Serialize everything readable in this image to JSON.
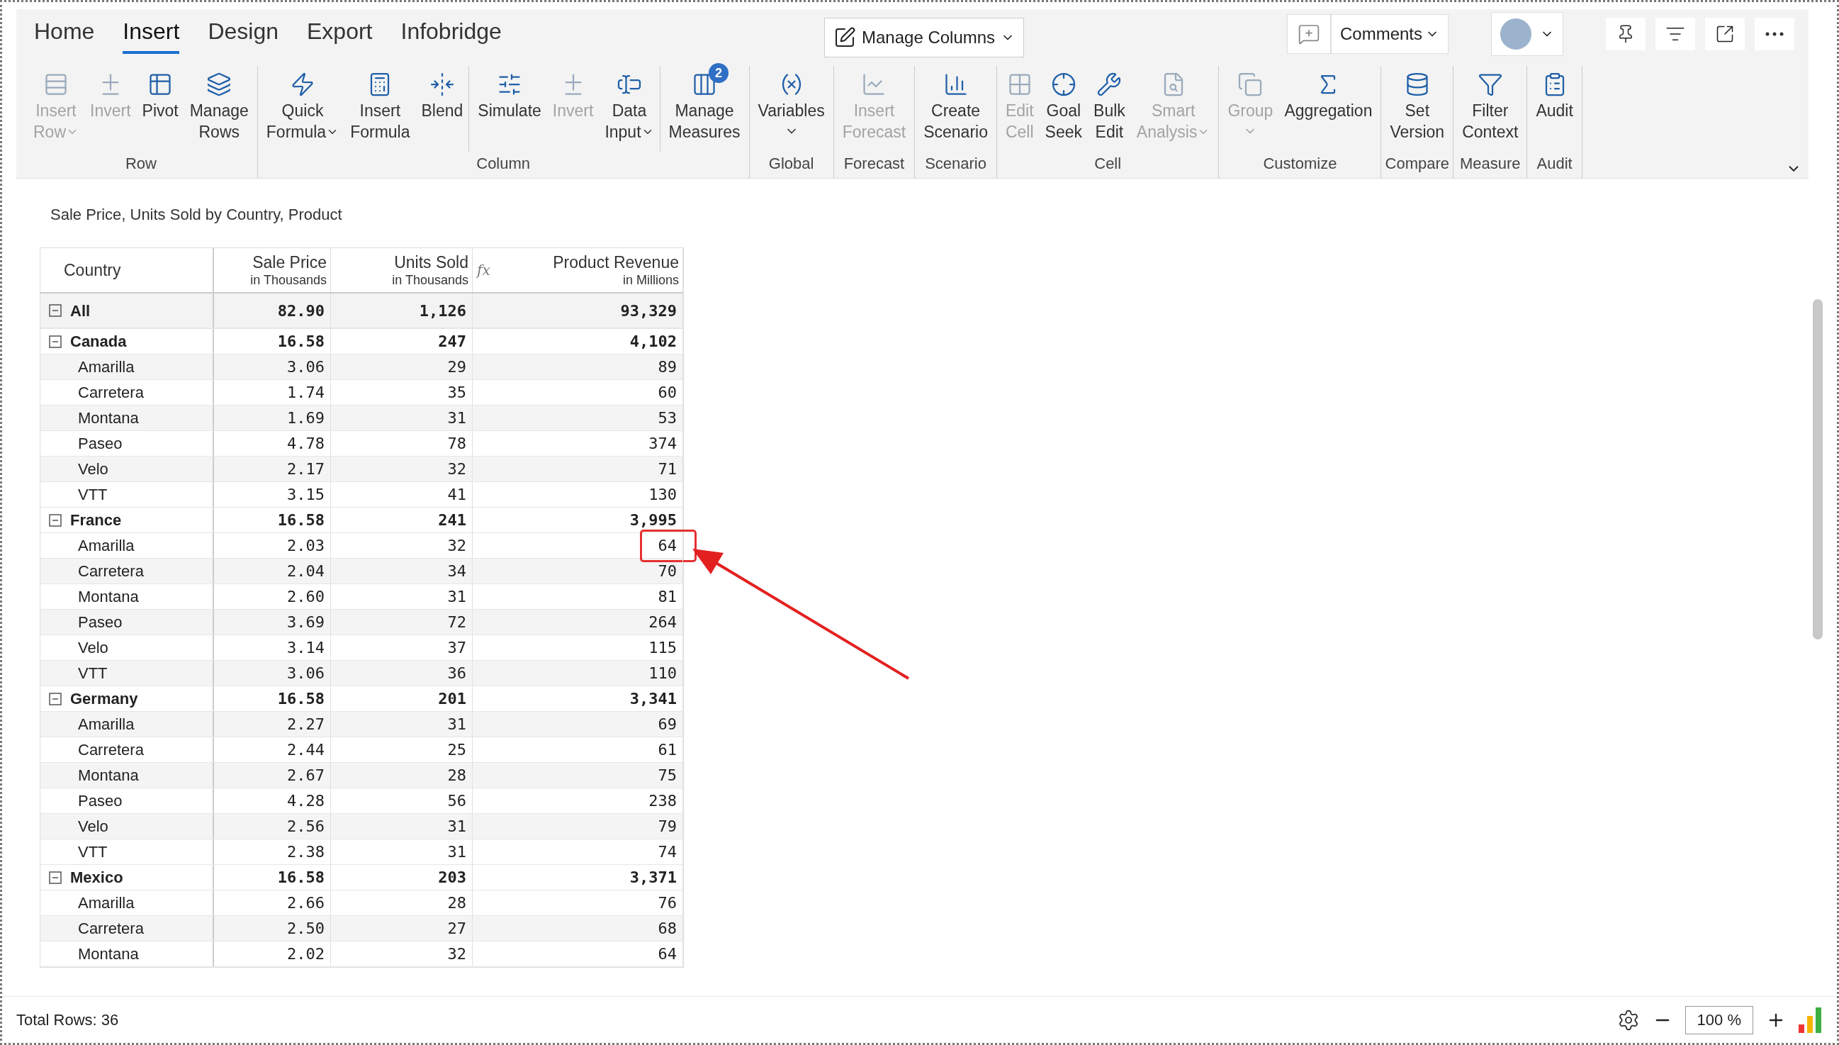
{
  "tabs": [
    {
      "label": "Home",
      "selected": false
    },
    {
      "label": "Insert",
      "selected": true
    },
    {
      "label": "Design",
      "selected": false
    },
    {
      "label": "Export",
      "selected": false
    },
    {
      "label": "Infobridge",
      "selected": false
    }
  ],
  "top_controls": {
    "manage_columns": "Manage Columns",
    "comments": "Comments"
  },
  "ribbon_groups": [
    {
      "label": "Row",
      "sections": [
        [
          {
            "lines": [
              "Insert",
              "Row"
            ],
            "disabled": true,
            "dropdown": true,
            "caret_below": false
          },
          {
            "lines": [
              "Invert"
            ],
            "disabled": true,
            "dropdown": false
          },
          {
            "lines": [
              "Pivot"
            ],
            "disabled": false,
            "dropdown": false
          },
          {
            "lines": [
              "Manage",
              "Rows"
            ],
            "disabled": false,
            "dropdown": false
          }
        ]
      ]
    },
    {
      "label": "Column",
      "sections": [
        [
          {
            "lines": [
              "Quick",
              "Formula"
            ],
            "disabled": false,
            "dropdown": true,
            "caret_below": false
          },
          {
            "lines": [
              "Insert",
              "Formula"
            ],
            "disabled": false,
            "dropdown": false
          },
          {
            "lines": [
              "Blend"
            ],
            "disabled": false,
            "dropdown": false
          }
        ],
        [
          {
            "lines": [
              "Simulate"
            ],
            "disabled": false,
            "dropdown": false
          },
          {
            "lines": [
              "Invert"
            ],
            "disabled": true,
            "dropdown": false
          },
          {
            "lines": [
              "Data",
              "Input"
            ],
            "disabled": false,
            "dropdown": true,
            "caret_below": false
          }
        ],
        [
          {
            "lines": [
              "Manage",
              "Measures"
            ],
            "disabled": false,
            "dropdown": false,
            "badge": "2"
          }
        ]
      ]
    },
    {
      "label": "Global",
      "sections": [
        [
          {
            "lines": [
              "Variables"
            ],
            "disabled": false,
            "dropdown": true,
            "caret_below": true
          }
        ]
      ]
    },
    {
      "label": "Forecast",
      "sections": [
        [
          {
            "lines": [
              "Insert",
              "Forecast"
            ],
            "disabled": true,
            "dropdown": false
          }
        ]
      ]
    },
    {
      "label": "Scenario",
      "sections": [
        [
          {
            "lines": [
              "Create",
              "Scenario"
            ],
            "disabled": false,
            "dropdown": false
          }
        ]
      ]
    },
    {
      "label": "Cell",
      "sections": [
        [
          {
            "lines": [
              "Edit",
              "Cell"
            ],
            "disabled": true,
            "dropdown": false
          },
          {
            "lines": [
              "Goal",
              "Seek"
            ],
            "disabled": false,
            "dropdown": false
          },
          {
            "lines": [
              "Bulk",
              "Edit"
            ],
            "disabled": false,
            "dropdown": false
          },
          {
            "lines": [
              "Smart",
              "Analysis"
            ],
            "disabled": true,
            "dropdown": true,
            "caret_below": false
          }
        ]
      ]
    },
    {
      "label": "Customize",
      "sections": [
        [
          {
            "lines": [
              "Group"
            ],
            "disabled": true,
            "dropdown": true,
            "caret_below": true
          },
          {
            "lines": [
              "Aggregation"
            ],
            "disabled": false,
            "dropdown": false
          }
        ]
      ]
    },
    {
      "label": "Compare",
      "sections": [
        [
          {
            "lines": [
              "Set",
              "Version"
            ],
            "disabled": false,
            "dropdown": false
          }
        ]
      ]
    },
    {
      "label": "Measure",
      "sections": [
        [
          {
            "lines": [
              "Filter",
              "Context"
            ],
            "disabled": false,
            "dropdown": false
          }
        ]
      ]
    },
    {
      "label": "Audit",
      "sections": [
        [
          {
            "lines": [
              "Audit"
            ],
            "disabled": false,
            "dropdown": false
          }
        ]
      ]
    }
  ],
  "subtitle": "Sale Price, Units Sold by Country, Product",
  "table": {
    "columns": [
      {
        "title": "Country"
      },
      {
        "title": "Sale Price",
        "unit": "in Thousands"
      },
      {
        "title": "Units Sold",
        "unit": "in Thousands"
      },
      {
        "title": "Product Revenue",
        "unit": "in Millions",
        "marker": "fx"
      }
    ],
    "rows": [
      {
        "kind": "total",
        "label": "All",
        "expanded": true,
        "values": [
          "82.90",
          "1,126",
          "93,329"
        ]
      },
      {
        "kind": "group",
        "label": "Canada",
        "expanded": true,
        "values": [
          "16.58",
          "247",
          "4,102"
        ]
      },
      {
        "kind": "item",
        "label": "Amarilla",
        "values": [
          "3.06",
          "29",
          "89"
        ]
      },
      {
        "kind": "item",
        "label": "Carretera",
        "values": [
          "1.74",
          "35",
          "60"
        ]
      },
      {
        "kind": "item",
        "label": "Montana",
        "values": [
          "1.69",
          "31",
          "53"
        ]
      },
      {
        "kind": "item",
        "label": "Paseo",
        "values": [
          "4.78",
          "78",
          "374"
        ]
      },
      {
        "kind": "item",
        "label": "Velo",
        "values": [
          "2.17",
          "32",
          "71"
        ]
      },
      {
        "kind": "item",
        "label": "VTT",
        "values": [
          "3.15",
          "41",
          "130"
        ]
      },
      {
        "kind": "group",
        "label": "France",
        "expanded": true,
        "values": [
          "16.58",
          "241",
          "3,995"
        ]
      },
      {
        "kind": "item",
        "label": "Amarilla",
        "values": [
          "2.03",
          "32",
          "64"
        ],
        "highlighted": true
      },
      {
        "kind": "item",
        "label": "Carretera",
        "values": [
          "2.04",
          "34",
          "70"
        ]
      },
      {
        "kind": "item",
        "label": "Montana",
        "values": [
          "2.60",
          "31",
          "81"
        ]
      },
      {
        "kind": "item",
        "label": "Paseo",
        "values": [
          "3.69",
          "72",
          "264"
        ]
      },
      {
        "kind": "item",
        "label": "Velo",
        "values": [
          "3.14",
          "37",
          "115"
        ]
      },
      {
        "kind": "item",
        "label": "VTT",
        "values": [
          "3.06",
          "36",
          "110"
        ]
      },
      {
        "kind": "group",
        "label": "Germany",
        "expanded": true,
        "values": [
          "16.58",
          "201",
          "3,341"
        ]
      },
      {
        "kind": "item",
        "label": "Amarilla",
        "values": [
          "2.27",
          "31",
          "69"
        ]
      },
      {
        "kind": "item",
        "label": "Carretera",
        "values": [
          "2.44",
          "25",
          "61"
        ]
      },
      {
        "kind": "item",
        "label": "Montana",
        "values": [
          "2.67",
          "28",
          "75"
        ]
      },
      {
        "kind": "item",
        "label": "Paseo",
        "values": [
          "4.28",
          "56",
          "238"
        ]
      },
      {
        "kind": "item",
        "label": "Velo",
        "values": [
          "2.56",
          "31",
          "79"
        ]
      },
      {
        "kind": "item",
        "label": "VTT",
        "values": [
          "2.38",
          "31",
          "74"
        ]
      },
      {
        "kind": "group",
        "label": "Mexico",
        "expanded": true,
        "values": [
          "16.58",
          "203",
          "3,371"
        ]
      },
      {
        "kind": "item",
        "label": "Amarilla",
        "values": [
          "2.66",
          "28",
          "76"
        ]
      },
      {
        "kind": "item",
        "label": "Carretera",
        "values": [
          "2.50",
          "27",
          "68"
        ]
      },
      {
        "kind": "item",
        "label": "Montana",
        "values": [
          "2.02",
          "32",
          "64"
        ]
      }
    ]
  },
  "status_bar": {
    "total_rows": "Total Rows: 36",
    "zoom": "100 %"
  }
}
